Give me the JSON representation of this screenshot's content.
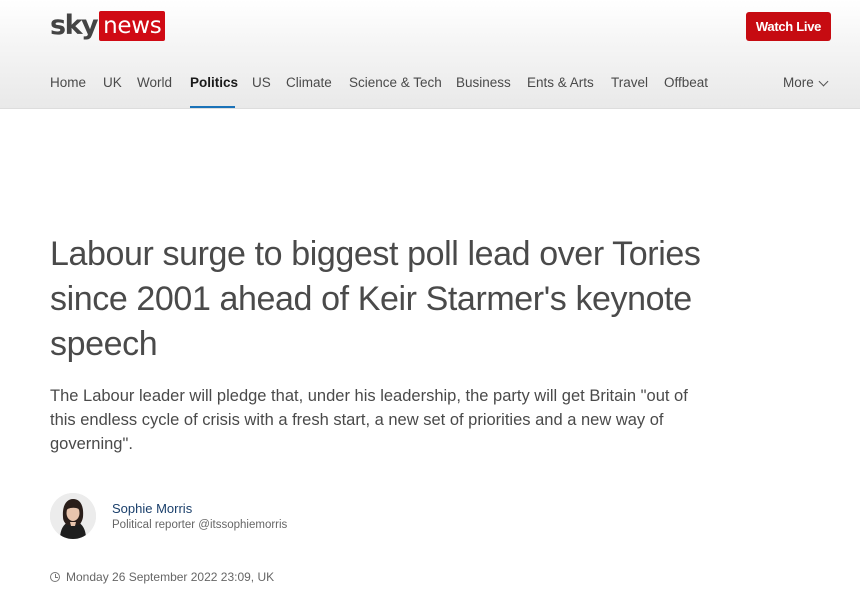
{
  "brand": {
    "sky": "sky",
    "news": "news",
    "accent_color": "#d00a14"
  },
  "header": {
    "watch_live_label": "Watch Live"
  },
  "nav": {
    "items": [
      "Home",
      "UK",
      "World",
      "Politics",
      "US",
      "Climate",
      "Science & Tech",
      "Business",
      "Ents & Arts",
      "Travel",
      "Offbeat"
    ],
    "active": "Politics",
    "more_label": "More"
  },
  "article": {
    "headline": "Labour surge to biggest poll lead over Tories since 2001 ahead of Keir Starmer's keynote speech",
    "standfirst": "The Labour leader will pledge that, under his leadership, the party will get Britain \"out of this endless cycle of crisis with a fresh start, a new set of priorities and a new way of governing\".",
    "author": {
      "name": "Sophie Morris",
      "role": "Political reporter",
      "handle": "@itssophiemorris"
    },
    "timestamp": "Monday 26 September 2022 23:09, UK"
  }
}
